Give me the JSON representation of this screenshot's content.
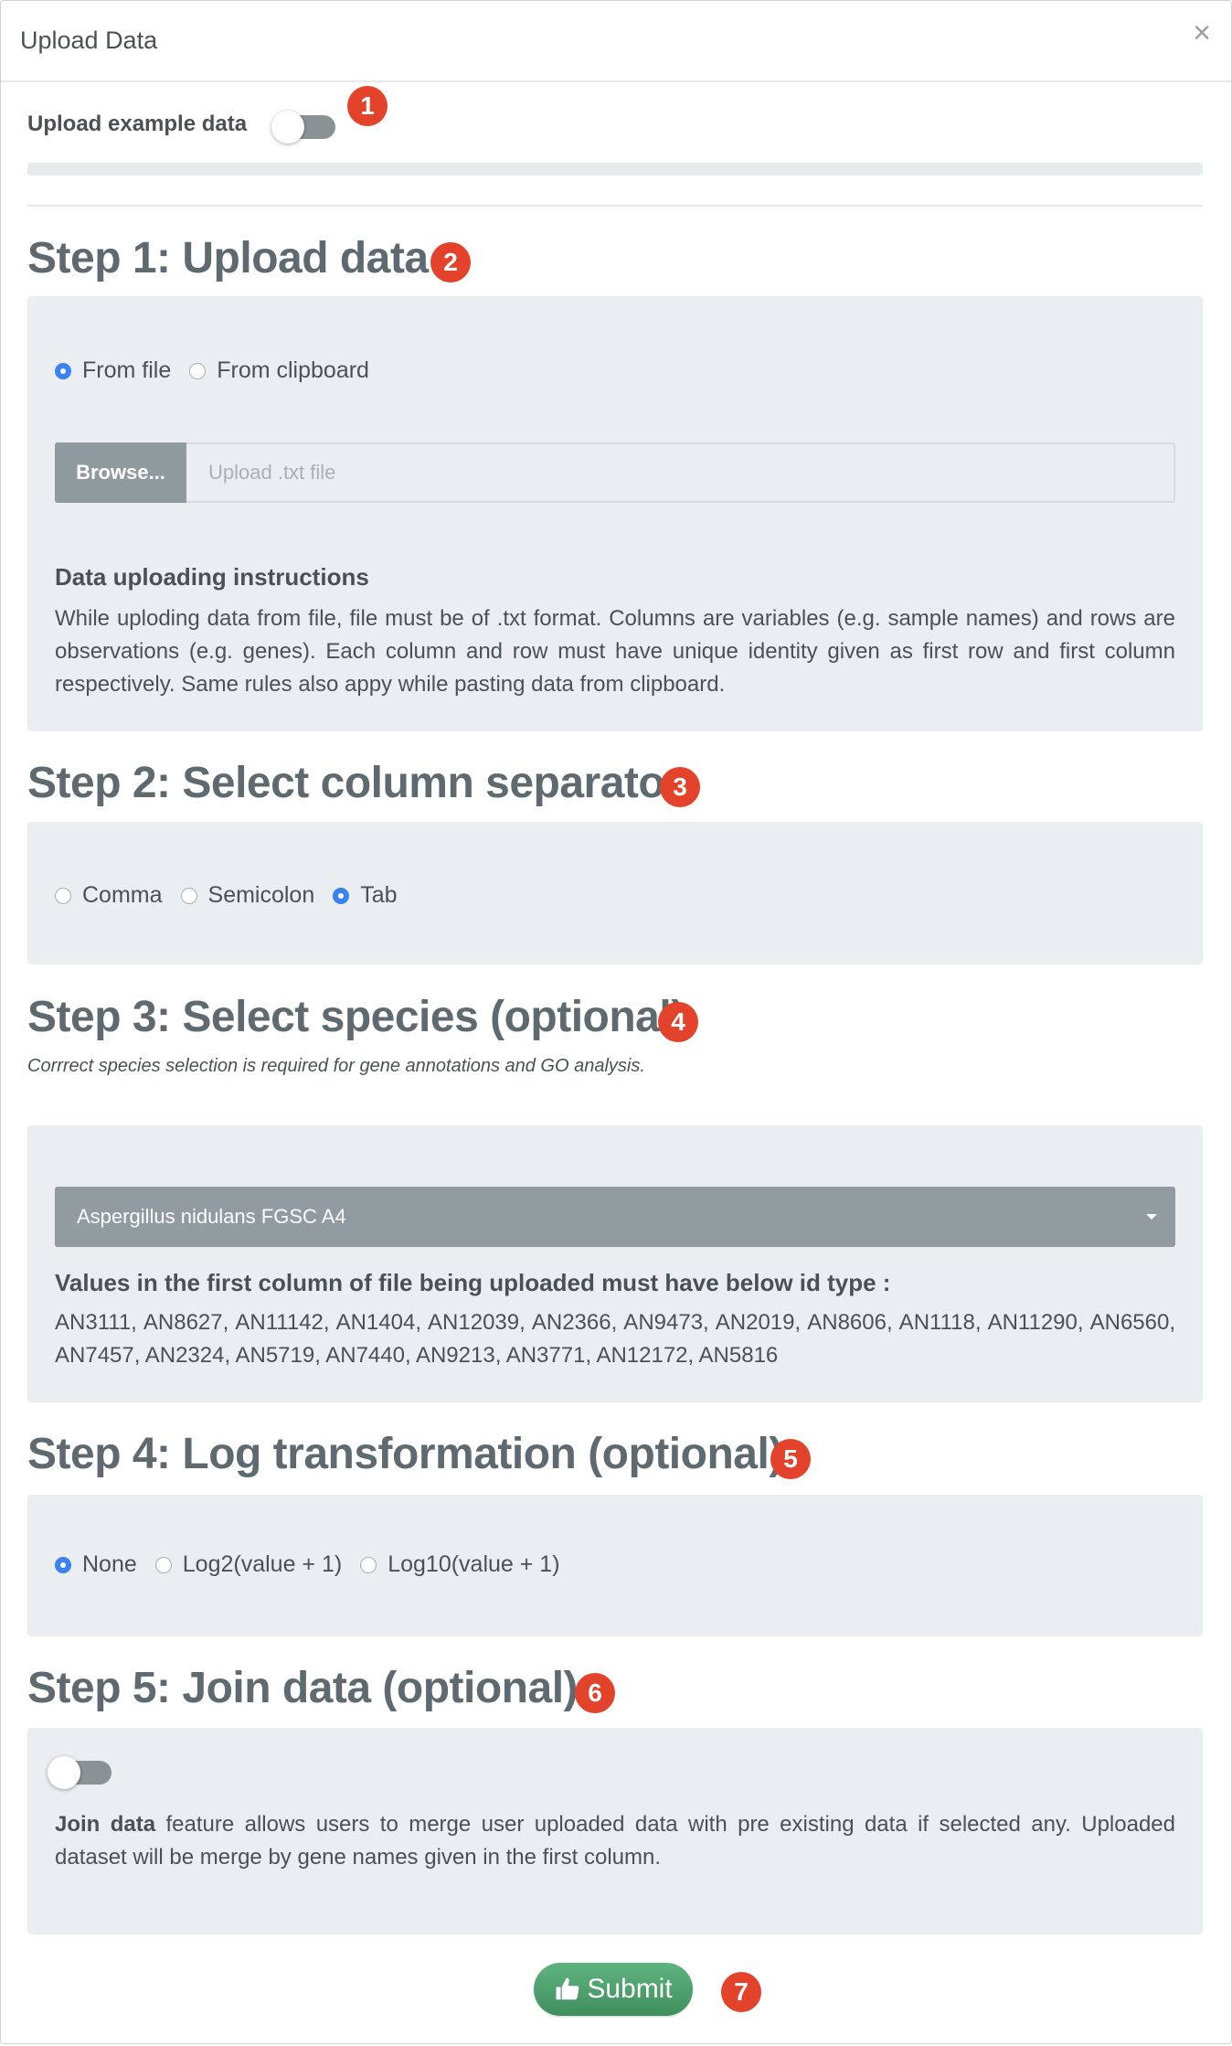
{
  "modal": {
    "title": "Upload Data",
    "close_symbol": "×"
  },
  "example": {
    "label": "Upload example data",
    "toggle_on": false
  },
  "badges": [
    "1",
    "2",
    "3",
    "4",
    "5",
    "6",
    "7"
  ],
  "step1": {
    "title": "Step 1: Upload data",
    "options": [
      "From file",
      "From clipboard"
    ],
    "selected": "From file",
    "browse_label": "Browse...",
    "file_placeholder": "Upload .txt file",
    "instructions_heading": "Data uploading instructions",
    "instructions_text": "While uploding data from file, file must be of .txt format. Columns are variables (e.g. sample names) and rows are observations (e.g. genes). Each column and row must have unique identity given as first row and first column respectively. Same rules also appy while pasting data from clipboard."
  },
  "step2": {
    "title": "Step 2: Select column separator",
    "options": [
      "Comma",
      "Semicolon",
      "Tab"
    ],
    "selected": "Tab"
  },
  "step3": {
    "title": "Step 3: Select species (optional)",
    "note": "Corrrect species selection is required for gene annotations and GO analysis.",
    "species_selected": "Aspergillus nidulans FGSC A4",
    "id_heading": "Values in the first column of file being uploaded must have below id type :",
    "id_examples": "AN3111, AN8627, AN11142, AN1404, AN12039, AN2366, AN9473, AN2019, AN8606, AN1118, AN11290, AN6560, AN7457, AN2324, AN5719, AN7440, AN9213, AN3771, AN12172, AN5816"
  },
  "step4": {
    "title": "Step 4: Log transformation (optional)",
    "options": [
      "None",
      "Log2(value + 1)",
      "Log10(value + 1)"
    ],
    "selected": "None"
  },
  "step5": {
    "title": "Step 5: Join data (optional)",
    "toggle_on": false,
    "join_bold": "Join data",
    "join_text": " feature allows users to merge user uploaded data with pre existing data if selected any. Uploaded dataset will be merge by gene names given in the first column."
  },
  "submit_label": "Submit",
  "colors": {
    "badge": "#e4432b",
    "radio_selected": "#3b82f0",
    "submit": "#4fa06d",
    "well": "#ebeef0"
  }
}
